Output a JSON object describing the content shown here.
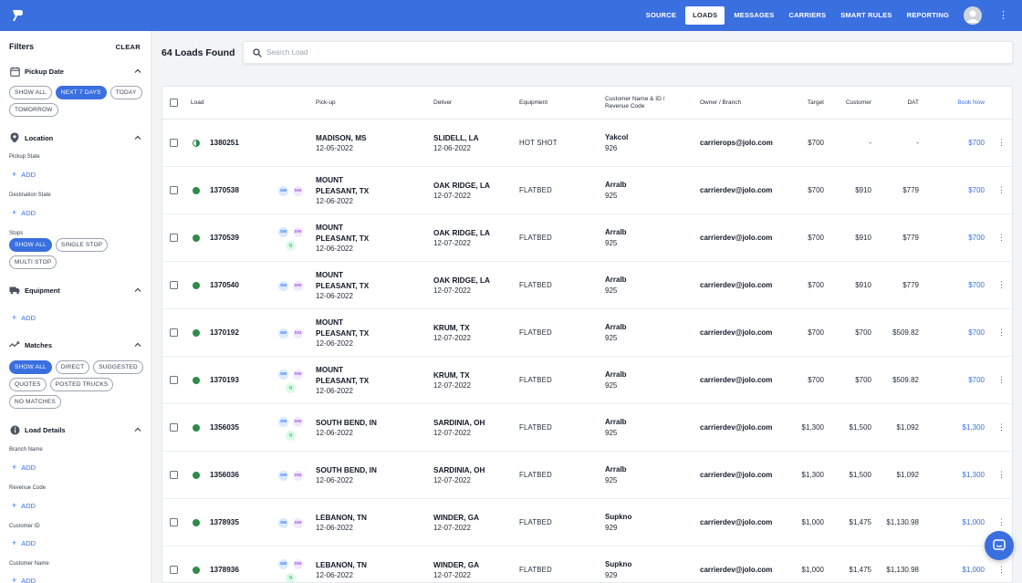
{
  "nav": {
    "links": [
      "SOURCE",
      "LOADS",
      "MESSAGES",
      "CARRIERS",
      "SMART RULES",
      "REPORTING"
    ],
    "active": "LOADS"
  },
  "sidebar": {
    "title": "Filters",
    "clear": "CLEAR",
    "pickup_date": {
      "label": "Pickup Date",
      "chips": [
        "SHOW ALL",
        "NEXT 7 DAYS",
        "TODAY",
        "TOMORROW"
      ],
      "selected": "NEXT 7 DAYS"
    },
    "location": {
      "label": "Location",
      "pickup_state": "Pickup State",
      "destination_state": "Destination State",
      "stops_label": "Stops",
      "stops_chips": [
        "SHOW ALL",
        "SINGLE STOP",
        "MULTI STOP"
      ],
      "stops_selected": "SHOW ALL"
    },
    "equipment": {
      "label": "Equipment"
    },
    "matches": {
      "label": "Matches",
      "chips": [
        "SHOW ALL",
        "DIRECT",
        "SUGGESTED",
        "QUOTES",
        "POSTED TRUCKS",
        "NO MATCHES"
      ],
      "selected": "SHOW ALL"
    },
    "load_details": {
      "label": "Load Details",
      "fields": [
        "Branch Name",
        "Revenue Code",
        "Customer ID",
        "Customer Name"
      ]
    },
    "add_label": "ADD"
  },
  "main": {
    "count_text": "64 Loads Found",
    "search_placeholder": "Search Load"
  },
  "table": {
    "headers": {
      "load": "Load",
      "pickup": "Pick-up",
      "deliver": "Deliver",
      "equipment": "Equipment",
      "customer_line1": "Customer Name & ID /",
      "customer_line2": "Revenue Code",
      "owner": "Owner / Branch",
      "target": "Target",
      "customer": "Customer",
      "dat": "DAT",
      "book_now": "Book Now"
    },
    "rows": [
      {
        "status": "partial",
        "load": "1380251",
        "badges": [],
        "pickup_city": [
          "MADISON, MS"
        ],
        "pickup_date": "12-05-2022",
        "deliver_city": "SLIDELL, LA",
        "deliver_date": "12-06-2022",
        "equipment": "HOT SHOT",
        "customer": "Yakcol",
        "customer_id": "926",
        "owner": "carrierops@jolo.com",
        "target": "$700",
        "customer_rate": "-",
        "dat": "-",
        "book": "$700"
      },
      {
        "status": "active",
        "load": "1370538",
        "badges": [
          "SM",
          "DM"
        ],
        "pickup_city": [
          "MOUNT",
          "PLEASANT, TX"
        ],
        "pickup_date": "12-06-2022",
        "deliver_city": "OAK RIDGE, LA",
        "deliver_date": "12-07-2022",
        "equipment": "FLATBED",
        "customer": "Arralb",
        "customer_id": "925",
        "owner": "carrierdev@jolo.com",
        "target": "$700",
        "customer_rate": "$910",
        "dat": "$779",
        "book": "$700"
      },
      {
        "status": "active",
        "load": "1370539",
        "badges": [
          "SM",
          "DM",
          "Q"
        ],
        "pickup_city": [
          "MOUNT",
          "PLEASANT, TX"
        ],
        "pickup_date": "12-06-2022",
        "deliver_city": "OAK RIDGE, LA",
        "deliver_date": "12-07-2022",
        "equipment": "FLATBED",
        "customer": "Arralb",
        "customer_id": "925",
        "owner": "carrierdev@jolo.com",
        "target": "$700",
        "customer_rate": "$910",
        "dat": "$779",
        "book": "$700"
      },
      {
        "status": "active",
        "load": "1370540",
        "badges": [
          "SM",
          "DM"
        ],
        "pickup_city": [
          "MOUNT",
          "PLEASANT, TX"
        ],
        "pickup_date": "12-06-2022",
        "deliver_city": "OAK RIDGE, LA",
        "deliver_date": "12-07-2022",
        "equipment": "FLATBED",
        "customer": "Arralb",
        "customer_id": "925",
        "owner": "carrierdev@jolo.com",
        "target": "$700",
        "customer_rate": "$910",
        "dat": "$779",
        "book": "$700"
      },
      {
        "status": "active",
        "load": "1370192",
        "badges": [
          "SM",
          "DM"
        ],
        "pickup_city": [
          "MOUNT",
          "PLEASANT, TX"
        ],
        "pickup_date": "12-06-2022",
        "deliver_city": "KRUM, TX",
        "deliver_date": "12-07-2022",
        "equipment": "FLATBED",
        "customer": "Arralb",
        "customer_id": "925",
        "owner": "carrierdev@jolo.com",
        "target": "$700",
        "customer_rate": "$700",
        "dat": "$509.82",
        "book": "$700"
      },
      {
        "status": "active",
        "load": "1370193",
        "badges": [
          "SM",
          "DM",
          "Q"
        ],
        "pickup_city": [
          "MOUNT",
          "PLEASANT, TX"
        ],
        "pickup_date": "12-06-2022",
        "deliver_city": "KRUM, TX",
        "deliver_date": "12-07-2022",
        "equipment": "FLATBED",
        "customer": "Arralb",
        "customer_id": "925",
        "owner": "carrierdev@jolo.com",
        "target": "$700",
        "customer_rate": "$700",
        "dat": "$509.82",
        "book": "$700"
      },
      {
        "status": "active",
        "load": "1356035",
        "badges": [
          "SM",
          "DM",
          "Q"
        ],
        "pickup_city": [
          "SOUTH BEND, IN"
        ],
        "pickup_date": "12-06-2022",
        "deliver_city": "SARDINIA, OH",
        "deliver_date": "12-07-2022",
        "equipment": "FLATBED",
        "customer": "Arralb",
        "customer_id": "925",
        "owner": "carrierdev@jolo.com",
        "target": "$1,300",
        "customer_rate": "$1,500",
        "dat": "$1,092",
        "book": "$1,300"
      },
      {
        "status": "active",
        "load": "1356036",
        "badges": [
          "SM",
          "DM"
        ],
        "pickup_city": [
          "SOUTH BEND, IN"
        ],
        "pickup_date": "12-06-2022",
        "deliver_city": "SARDINIA, OH",
        "deliver_date": "12-07-2022",
        "equipment": "FLATBED",
        "customer": "Arralb",
        "customer_id": "925",
        "owner": "carrierdev@jolo.com",
        "target": "$1,300",
        "customer_rate": "$1,500",
        "dat": "$1,092",
        "book": "$1,300"
      },
      {
        "status": "active",
        "load": "1378935",
        "badges": [
          "SM",
          "DM"
        ],
        "pickup_city": [
          "LEBANON, TN"
        ],
        "pickup_date": "12-06-2022",
        "deliver_city": "WINDER, GA",
        "deliver_date": "12-07-2022",
        "equipment": "FLATBED",
        "customer": "Supkno",
        "customer_id": "929",
        "owner": "carrierdev@jolo.com",
        "target": "$1,000",
        "customer_rate": "$1,475",
        "dat": "$1,130.98",
        "book": "$1,000"
      },
      {
        "status": "active",
        "load": "1378936",
        "badges": [
          "SM",
          "DM",
          "Q"
        ],
        "pickup_city": [
          "LEBANON, TN"
        ],
        "pickup_date": "12-06-2022",
        "deliver_city": "WINDER, GA",
        "deliver_date": "12-07-2022",
        "equipment": "FLATBED",
        "customer": "Supkno",
        "customer_id": "929",
        "owner": "carrierdev@jolo.com",
        "target": "$1,000",
        "customer_rate": "$1,475",
        "dat": "$1,130.98",
        "book": "$1,000"
      }
    ]
  },
  "colors": {
    "brand": "#3a6fe0",
    "status_green": "#2e8b4a"
  }
}
